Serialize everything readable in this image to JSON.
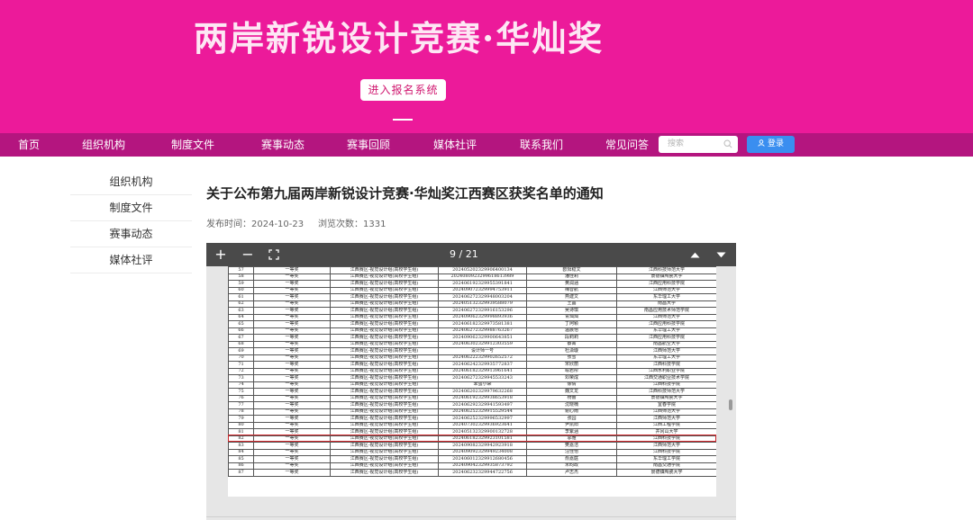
{
  "banner": {
    "title": "两岸新锐设计竞赛·华灿奖",
    "enter_button": "进入报名系统",
    "bg_color": "#ec1a9a"
  },
  "nav": {
    "items": [
      "首页",
      "组织机构",
      "制度文件",
      "赛事动态",
      "赛事回顾",
      "媒体社评",
      "联系我们",
      "常见问答"
    ],
    "search_placeholder": "搜索",
    "search_icon": "search-icon",
    "login_label": "登录",
    "login_icon": "user-icon",
    "bg_color": "#b4157f"
  },
  "sidebar": {
    "items": [
      "组织机构",
      "制度文件",
      "赛事动态",
      "媒体社评"
    ]
  },
  "article": {
    "title": "关于公布第九届两岸新锐设计竞赛·华灿奖江西赛区获奖名单的通知",
    "publish_label": "发布时间：2024-10-23",
    "views_label": "浏览次数：1331"
  },
  "viewer": {
    "zoom_in": "+",
    "zoom_out": "−",
    "fullscreen_icon": "fullscreen-icon",
    "page_indicator": "9 / 21",
    "prev_icon": "triangle-up-icon",
    "next_icon": "triangle-down-icon",
    "highlight_row_index": 23,
    "rows": [
      [
        "57",
        "一等奖",
        "江西赛区-视觉设计组(高校学生组)",
        "20240520232990640013​4",
        "欧阳稳文",
        "江西科技师范大学"
      ],
      [
        "58",
        "一等奖",
        "江西赛区-视觉设计组(高校学生组)",
        "20240809232996186139​89",
        "潘佳莉",
        "景德镇陶瓷大学"
      ],
      [
        "59",
        "一等奖",
        "江西赛区-视觉设计组(高校学生组)",
        "20240619232995539184​1",
        "黄润涵",
        "江西应用科技学院"
      ],
      [
        "60",
        "一等奖",
        "江西赛区-视觉设计组(高校学生组)",
        "20240907232999475391​1",
        "梅智航",
        "江西师范大学"
      ],
      [
        "61",
        "一等奖",
        "江西赛区-视觉设计组(高校学生组)",
        "20240627232994800320​4",
        "燕建文",
        "东华理工大学"
      ],
      [
        "62",
        "一等奖",
        "江西赛区-视觉设计组(高校学生组)",
        "20240513232993958807​9",
        "王晶",
        "南昌大学"
      ],
      [
        "63",
        "一等奖",
        "江西赛区-视觉设计组(高校学生组)",
        "20240627232991615329​6",
        "吴诗琪",
        "南昌应用技术师范学院"
      ],
      [
        "64",
        "一等奖",
        "江西赛区-视觉设计组(高校学生组)",
        "20240906232999889393​6",
        "青灿灿",
        "江西师范大学"
      ],
      [
        "65",
        "一等奖",
        "江西赛区-视觉设计组(高校学生组)",
        "20240618232997358138​1",
        "丁阿颖",
        "江西应用科技学院"
      ],
      [
        "66",
        "一等奖",
        "江西赛区-视觉设计组(高校学生组)",
        "20240627232998876326​7",
        "温晨怡",
        "东华理工大学"
      ],
      [
        "67",
        "一等奖",
        "江西赛区-视觉设计组(高校学生组)",
        "20240906232990064385​1",
        "段莉莉",
        "江西应用科技学院"
      ],
      [
        "68",
        "一等奖",
        "江西赛区-视觉设计组(高校学生组)",
        "20240630232991230355​9",
        "蔡菁",
        "南昌航空大学"
      ],
      [
        "69",
        "一等奖",
        "江西赛区-视觉设计组(高校学生组)",
        "设计师一号",
        "杜潇璇",
        "江西师范大学"
      ],
      [
        "70",
        "一等奖",
        "江西赛区-视觉设计组(高校学生组)",
        "20240622232990265257​2",
        "张雪",
        "东华理工大学"
      ],
      [
        "71",
        "一等奖",
        "江西赛区-视觉设计组(高校学生组)",
        "20240624232993577283​7",
        "宋欣丽",
        "江西科技学院"
      ],
      [
        "72",
        "一等奖",
        "江西赛区-视觉设计组(高校学生组)",
        "20240618232991396164​1",
        "喻若彤",
        "江西水利职业学院"
      ],
      [
        "73",
        "一等奖",
        "江西赛区-视觉设计组(高校学生组)",
        "20240627232994553324​3",
        "邓荣成",
        "江西交通职业技术学院"
      ],
      [
        "74",
        "一等奖",
        "江西赛区-视觉设计组(高校学生组)",
        "笨蛋小朵",
        "徐倩",
        "江西科技学院"
      ],
      [
        "75",
        "一等奖",
        "江西赛区-视觉设计组(高校学生组)",
        "20240620232997963226​8",
        "魏文龙",
        "江西科技师范大学"
      ],
      [
        "76",
        "一等奖",
        "江西赛区-视觉设计组(高校学生组)",
        "20240619232993865391​8",
        "杨蕾",
        "景德镇陶瓷大学"
      ],
      [
        "77",
        "一等奖",
        "江西赛区-视觉设计组(高校学生组)",
        "20240629232994159349​7",
        "沈晓楠",
        "宜春学院"
      ],
      [
        "78",
        "一等奖",
        "江西赛区-视觉设计组(高校学生组)",
        "20240625232991552954​4",
        "谢心雨",
        "江西师范大学"
      ],
      [
        "79",
        "一等奖",
        "江西赛区-视觉设计组(高校学生组)",
        "20240625232999653299​7",
        "张园",
        "江西师范大学"
      ],
      [
        "80",
        "一等奖",
        "江西赛区-视觉设计组(高校学生组)",
        "20240730232993692364​1",
        "尹凯阳",
        "江西工程学院"
      ],
      [
        "81",
        "一等奖",
        "江西赛区-视觉设计组(高校学生组)",
        "20240513232990013272​8",
        "李紫涵",
        "井冈山大学"
      ],
      [
        "82",
        "一等奖",
        "江西赛区-视觉设计组(高校学生组)",
        "20240618232992310158​1",
        "邬雅",
        "江西科技学院"
      ],
      [
        "83",
        "一等奖",
        "江西赛区-视觉设计组(高校学生组)",
        "20240908232994292391​8",
        "樊嘉洁",
        "江西师范大学"
      ],
      [
        "84",
        "一等奖",
        "江西赛区-视觉设计组(高校学生组)",
        "20240909232994923400​8",
        "汪佳怡",
        "江西科技学院"
      ],
      [
        "85",
        "一等奖",
        "江西赛区-视觉设计组(高校学生组)",
        "20240601232991268045​6",
        "俞嘉庭",
        "东华理工学院"
      ],
      [
        "86",
        "一等奖",
        "江西赛区-视觉设计组(高校学生组)",
        "20240904232993587379​2",
        "宋昀政",
        "南昌交通学院"
      ],
      [
        "87",
        "一等奖",
        "江西赛区-视觉设计组(高校学生组)",
        "20240623232994472275​6",
        "卢志杰",
        "景德镇陶瓷大学"
      ]
    ]
  }
}
